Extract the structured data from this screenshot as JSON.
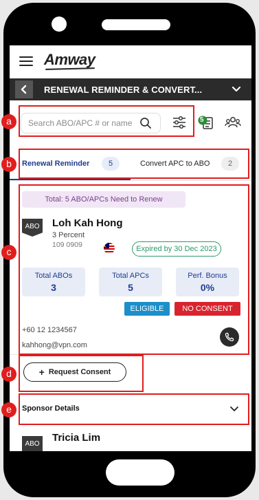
{
  "app": {
    "logo": "Amway",
    "page_title": "RENEWAL REMINDER & CONVERT..."
  },
  "search": {
    "placeholder": "Search ABO/APC # or name",
    "notification_count": "5"
  },
  "tabs": [
    {
      "label": "Renewal Reminder",
      "count": "5",
      "active": true
    },
    {
      "label": "Convert APC to ABO",
      "count": "2",
      "active": false
    }
  ],
  "summary": {
    "total_text": "Total: 5 ABO/APCs Need to Renew"
  },
  "member": {
    "type_tag": "ABO",
    "name": "Loh Kah Hong",
    "level": "3 Percent",
    "id": "109 0909",
    "country_flag": "malaysia-flag-icon",
    "status": "Expired by 30 Dec 2023",
    "stats": [
      {
        "label": "Total ABOs",
        "value": "3"
      },
      {
        "label": "Total APCs",
        "value": "5"
      },
      {
        "label": "Perf. Bonus",
        "value": "0%"
      }
    ],
    "eligibility": "ELIGIBLE",
    "consent": "NO CONSENT",
    "phone": "+60 12 1234567",
    "email": "kahhong@vpn.com"
  },
  "actions": {
    "request_consent": "Request Consent"
  },
  "sponsor": {
    "label": "Sponsor Details"
  },
  "next_member": {
    "type_tag": "ABO",
    "name": "Tricia Lim"
  },
  "annotations": {
    "a": "a",
    "b": "b",
    "c": "c",
    "d": "d",
    "e": "e"
  },
  "colors": {
    "accent_blue": "#1e3d8f",
    "eligible_blue": "#1b8fc9",
    "no_consent_red": "#d8242e",
    "expired_green": "#2d9a6a",
    "annotation_red": "#e11d1d"
  }
}
